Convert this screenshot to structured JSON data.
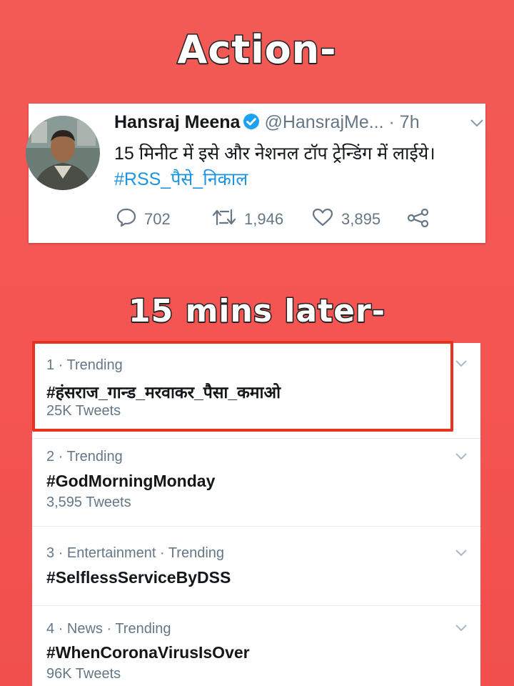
{
  "headings": {
    "action": "Action-",
    "later": "15 mins later-"
  },
  "tweet": {
    "name": "Hansraj Meena",
    "handle": "@HansrajMe...",
    "time": "· 7h",
    "text": "15 मिनीट में इसे और नेशनल टॉप ट्रेन्डिंग में लाईये।",
    "hashtag": "#RSS_पैसे_निकाल",
    "replies": "702",
    "retweets": "1,946",
    "likes": "3,895",
    "icons": [
      "verified-badge-icon",
      "chevron-down-icon",
      "reply-icon",
      "retweet-icon",
      "like-icon",
      "share-icon"
    ],
    "colors": {
      "link": "#1b95e0",
      "verified": "#1da1f2"
    }
  },
  "trends": [
    {
      "meta": "1 · Trending",
      "name": "#हंसराज_गान्ड_मरवाकर_पैसा_कमाओ",
      "count": "25K Tweets"
    },
    {
      "meta": "2 · Trending",
      "name": "#GodMorningMonday",
      "count": "3,595 Tweets"
    },
    {
      "meta": "3 · Entertainment · Trending",
      "name": "#SelflessServiceByDSS",
      "count": ""
    },
    {
      "meta": "4 · News · Trending",
      "name": "#WhenCoronaVirusIsOver",
      "count": "96K Tweets"
    }
  ],
  "colors": {
    "background": "#f25a55",
    "highlight": "#e8321f"
  }
}
